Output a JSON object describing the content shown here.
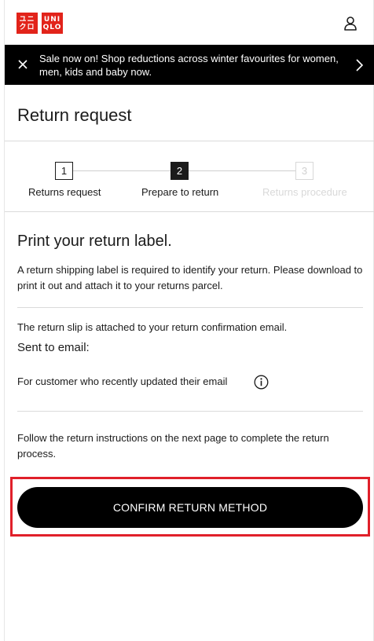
{
  "header": {
    "logo_left": [
      "ユニ",
      "クロ"
    ],
    "logo_right": [
      "UNI",
      "QLO"
    ],
    "brand_color": "#e2231a",
    "account_icon": "user-icon"
  },
  "banner": {
    "text": "Sale now on! Shop reductions across winter favourites for women, men, kids and baby now.",
    "close_icon": "close-icon",
    "next_icon": "chevron-right-icon"
  },
  "page": {
    "title": "Return request"
  },
  "steps": [
    {
      "number": "1",
      "label": "Returns request",
      "state": "done"
    },
    {
      "number": "2",
      "label": "Prepare to return",
      "state": "active"
    },
    {
      "number": "3",
      "label": "Returns procedure",
      "state": "disabled"
    }
  ],
  "content": {
    "section_title": "Print your return label.",
    "intro": "A return shipping label is required to identify your return. Please download to print it out and attach it to your returns parcel.",
    "slip_note": "The return slip is attached to your return confirmation email.",
    "sent_to_email_label": "Sent to email:",
    "updated_email_note": "For customer who recently updated their email",
    "info_icon": "info-icon",
    "instructions": "Follow the return instructions on the next page to complete the return process."
  },
  "actions": {
    "confirm_label": "CONFIRM RETURN METHOD",
    "highlight_color": "#e0202a"
  }
}
